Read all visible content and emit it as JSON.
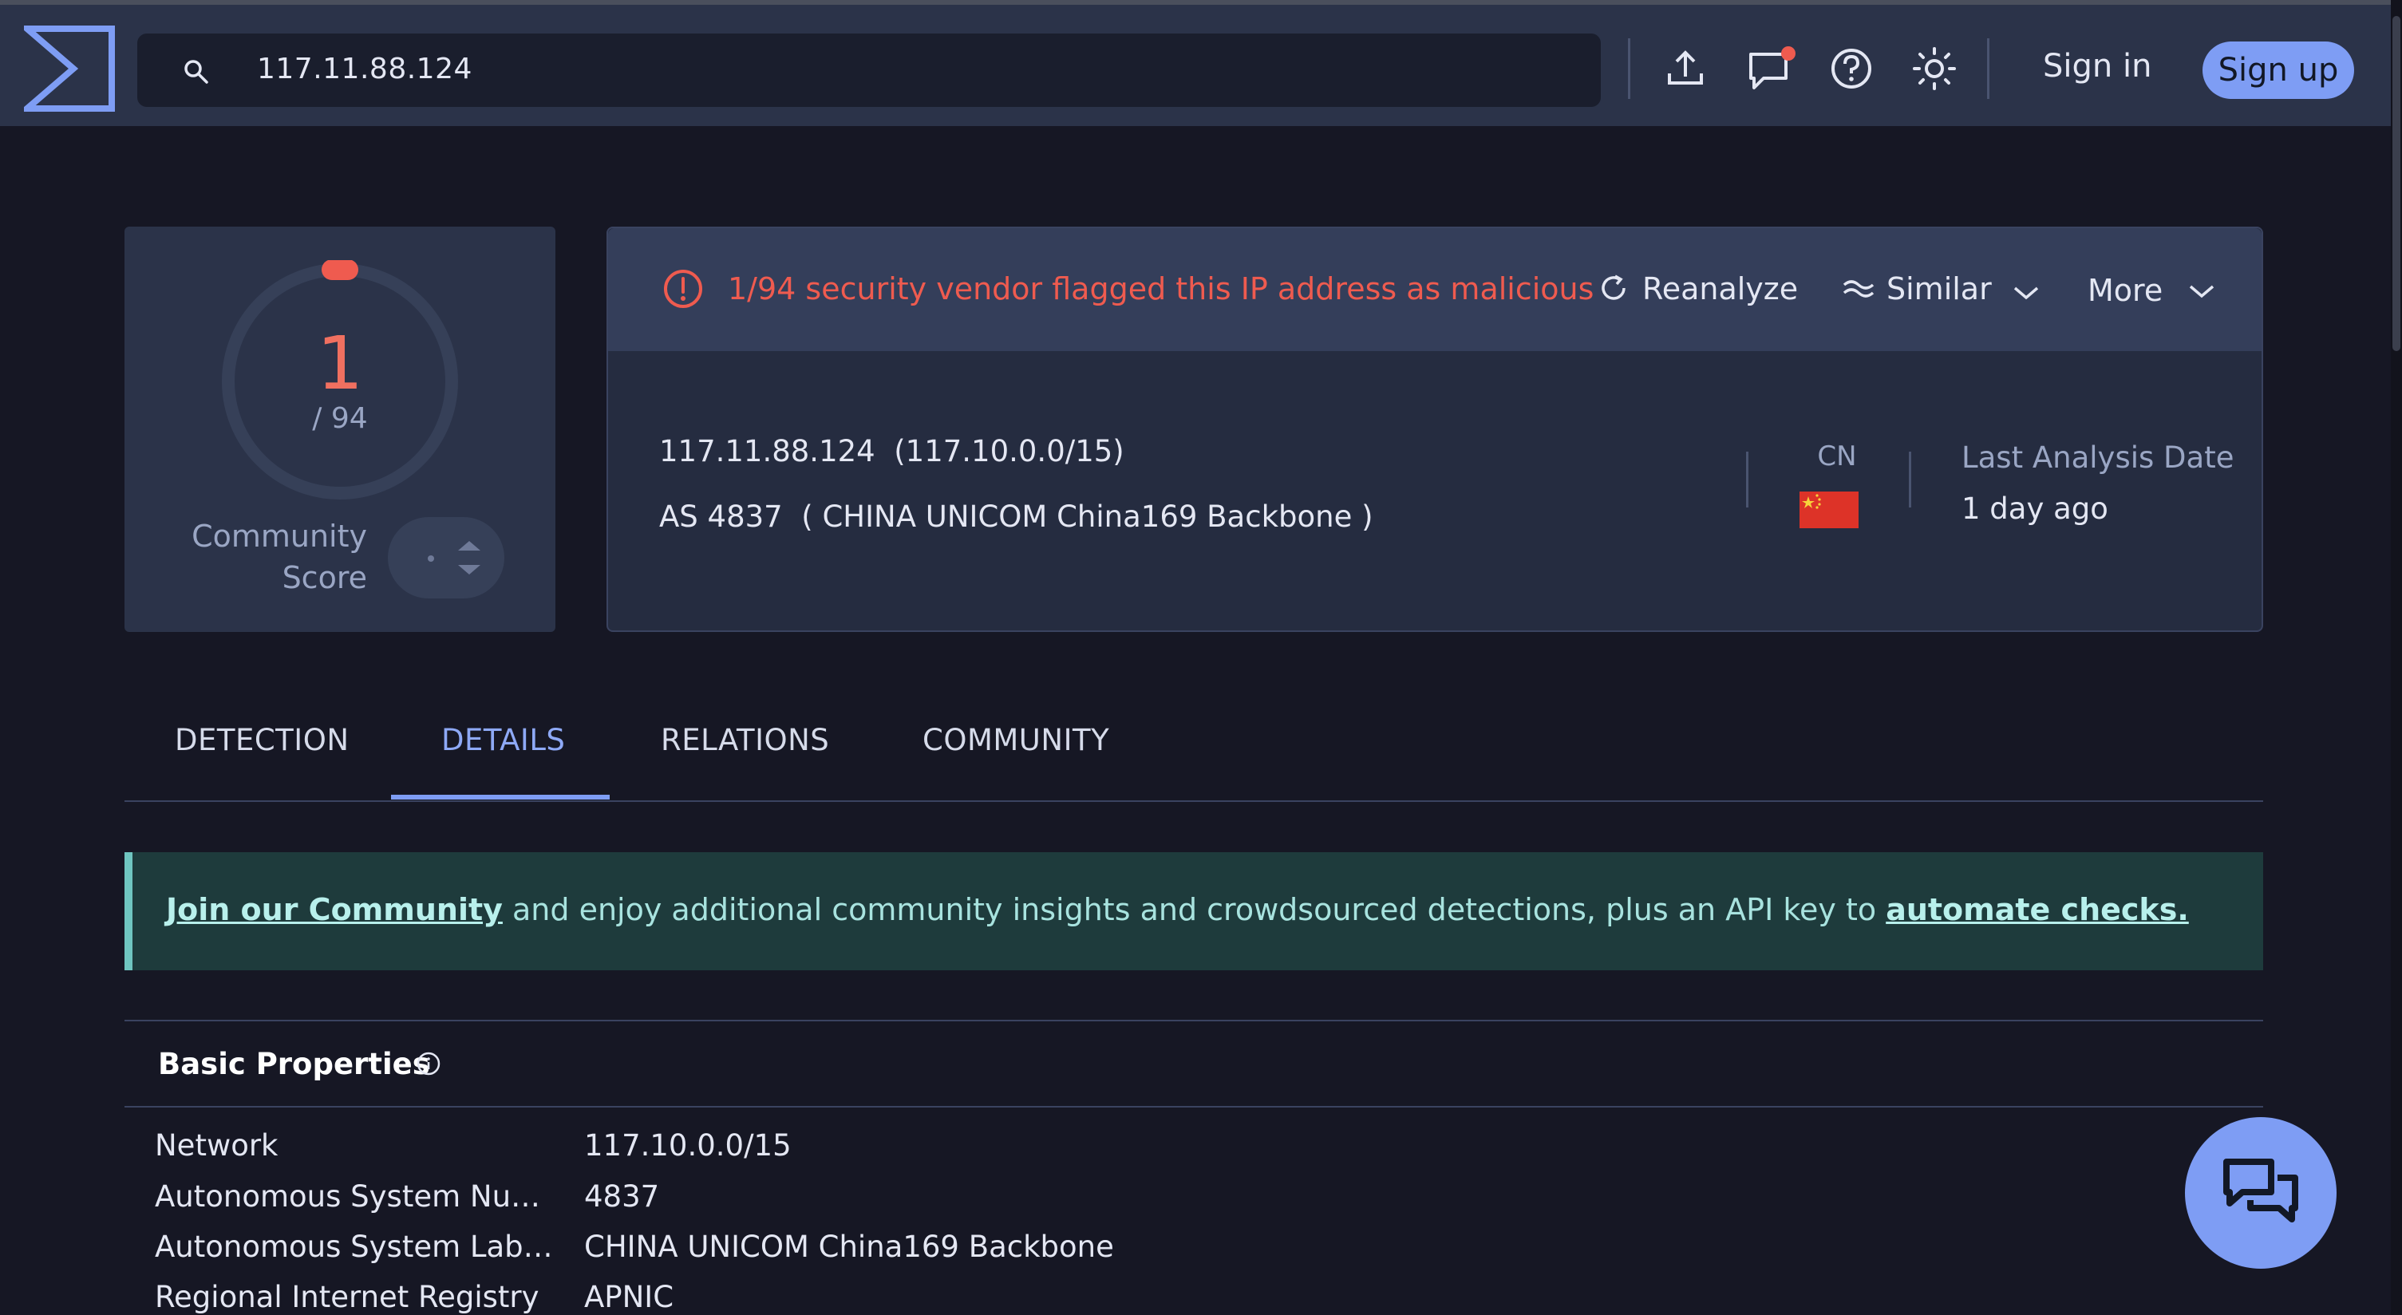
{
  "search": {
    "value": "117.11.88.124"
  },
  "header": {
    "signin": "Sign in",
    "signup": "Sign up"
  },
  "score": {
    "value": "1",
    "total": "/ 94",
    "label_line1": "Community",
    "label_line2": "Score"
  },
  "alert": {
    "text": "1/94 security vendor flagged this IP address as malicious",
    "reanalyze": "Reanalyze",
    "similar": "Similar",
    "more": "More"
  },
  "ip": {
    "address": "117.11.88.124",
    "cidr": "(117.10.0.0/15)",
    "as": "AS 4837",
    "as_name": "( CHINA UNICOM China169 Backbone )",
    "country": "CN",
    "last_analysis_label": "Last Analysis Date",
    "last_analysis_value": "1 day ago"
  },
  "tabs": [
    {
      "label": "DETECTION"
    },
    {
      "label": "DETAILS"
    },
    {
      "label": "RELATIONS"
    },
    {
      "label": "COMMUNITY"
    }
  ],
  "banner": {
    "link1": "Join our Community",
    "middle": " and enjoy additional community insights and crowdsourced detections, plus an API key to ",
    "link2": "automate checks."
  },
  "basic_properties": {
    "title": "Basic Properties",
    "rows": [
      {
        "key": "Network",
        "value": "117.10.0.0/15"
      },
      {
        "key": "Autonomous System Num…",
        "value": "4837"
      },
      {
        "key": "Autonomous System Label…",
        "value": "CHINA UNICOM China169 Backbone"
      },
      {
        "key": "Regional Internet Registry",
        "value": "APNIC"
      }
    ]
  },
  "colors": {
    "accent": "#7e9df4",
    "danger": "#ef5b4f",
    "banner": "#1e3b3c"
  }
}
